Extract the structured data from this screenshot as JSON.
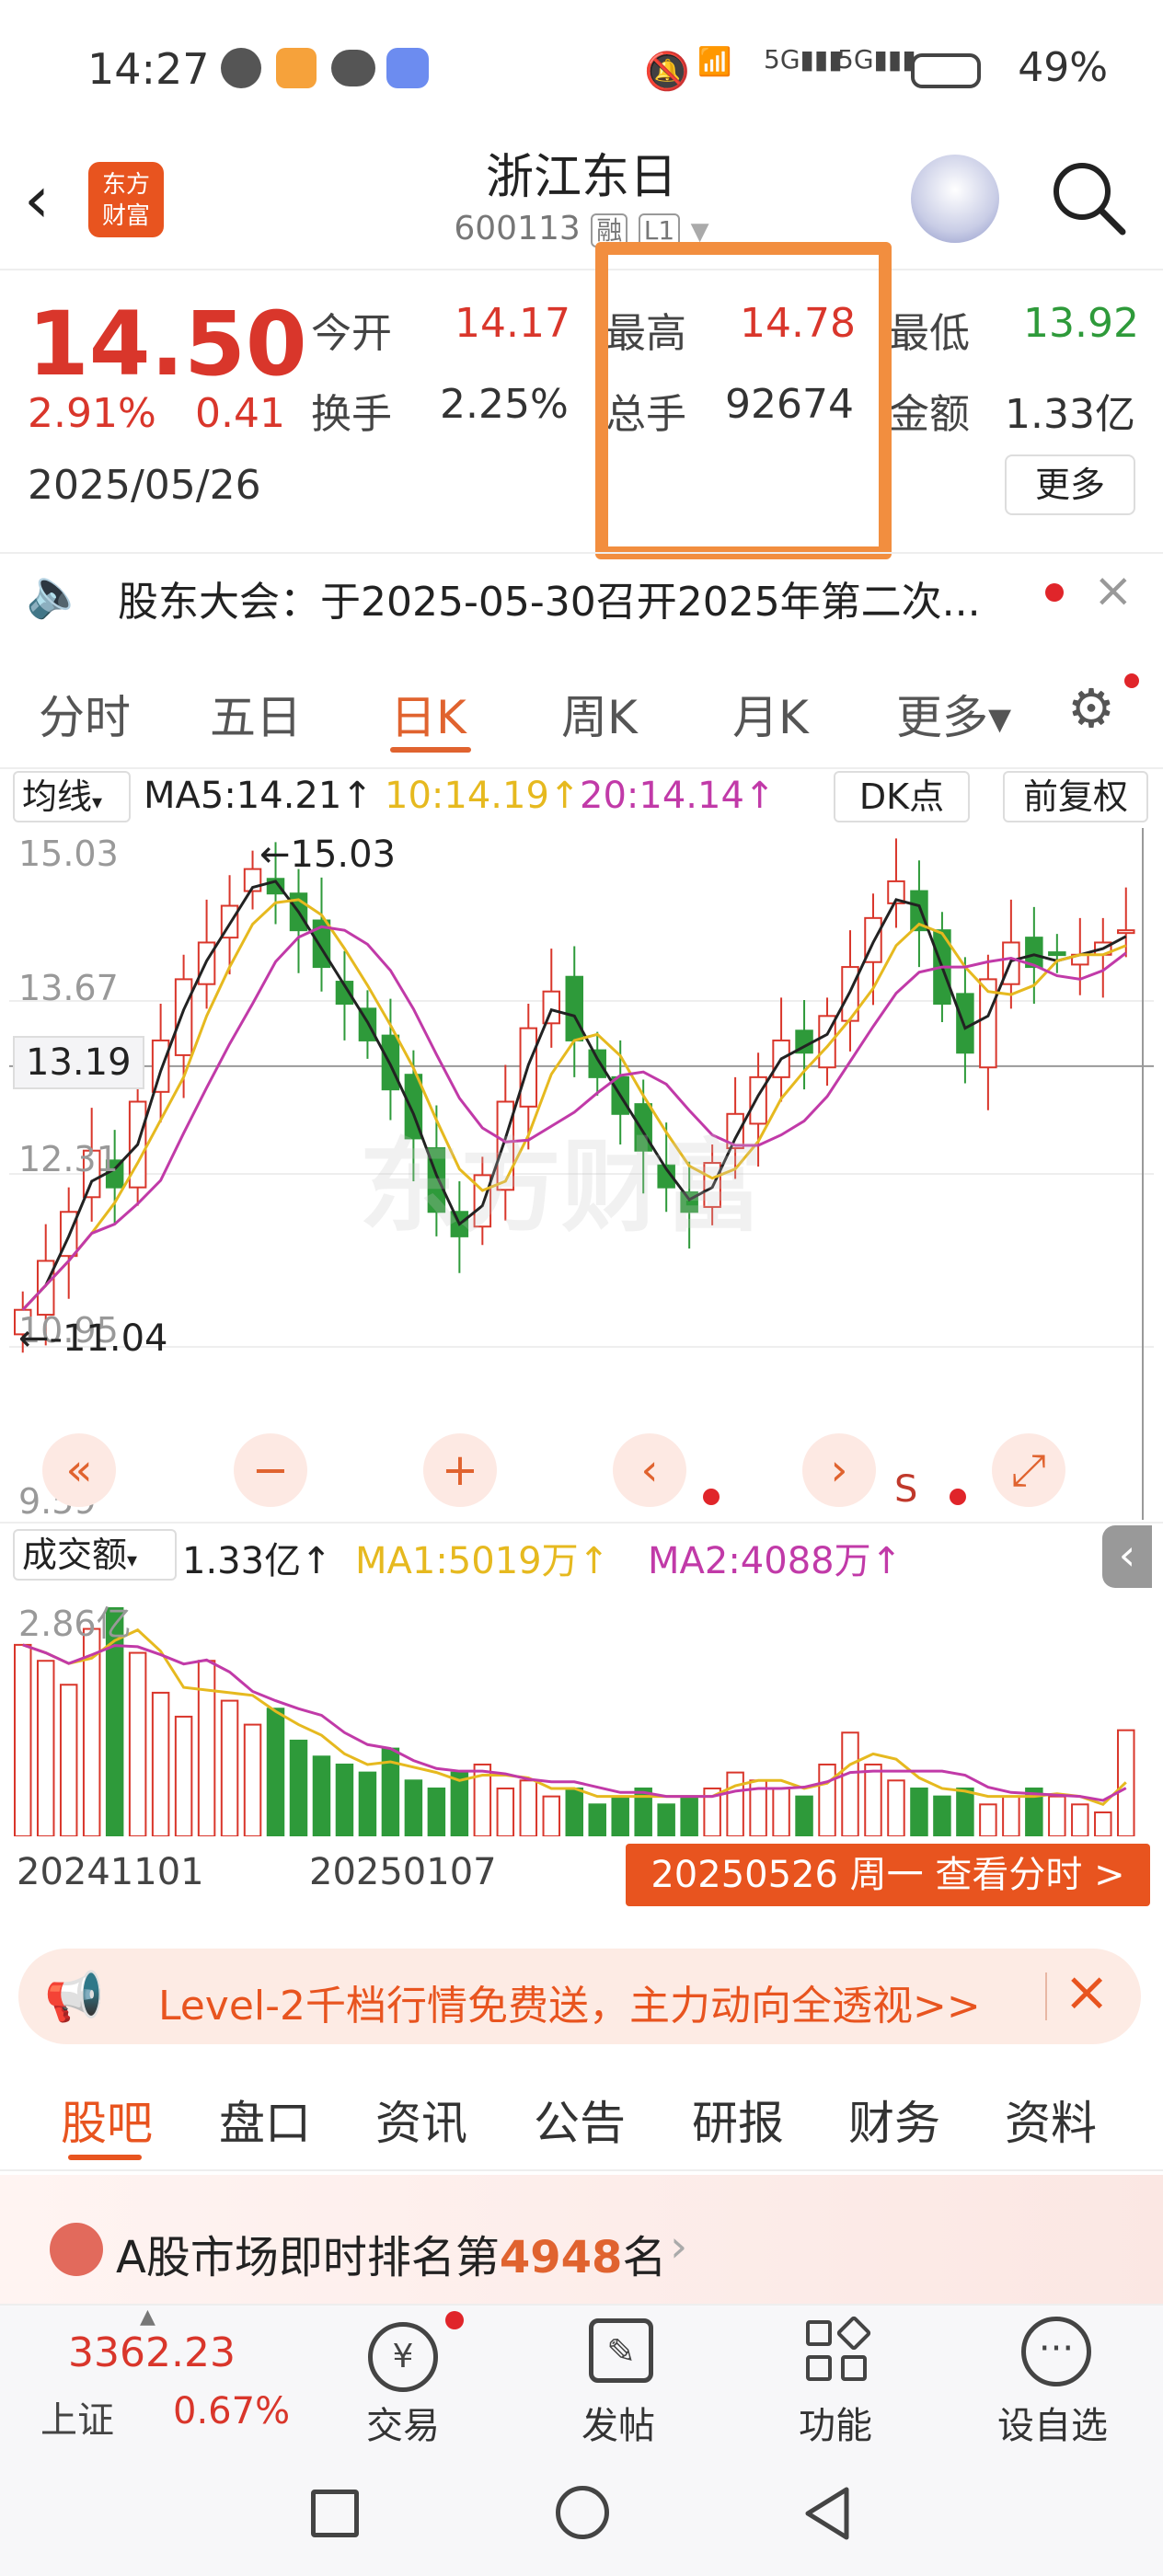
{
  "status_bar": {
    "time": "14:27",
    "battery": "49%",
    "net1": "5G",
    "net2": "5G"
  },
  "header": {
    "title": "浙江东日",
    "code": "600113",
    "tag1": "融",
    "tag2": "L1",
    "logo_text": "东方\n财富"
  },
  "quote": {
    "price": "14.50",
    "change_pct": "2.91%",
    "change": "0.41",
    "date": "2025/05/26",
    "open_label": "今开",
    "open": "14.17",
    "high_label": "最高",
    "high": "14.78",
    "low_label": "最低",
    "low": "13.92",
    "turnover_label": "换手",
    "turnover": "2.25%",
    "volume_label": "总手",
    "volume": "92674",
    "amount_label": "金额",
    "amount": "1.33亿",
    "more_label": "更多"
  },
  "notice": {
    "text": "股东大会：于2025-05-30召开2025年第二次..."
  },
  "tabs": [
    {
      "label": "分时"
    },
    {
      "label": "五日"
    },
    {
      "label": "日K"
    },
    {
      "label": "周K"
    },
    {
      "label": "月K"
    },
    {
      "label": "更多▾"
    }
  ],
  "active_tab": "日K",
  "ma_bar": {
    "selector": "均线",
    "ma5": "MA5:14.21↑",
    "ma10": "10:14.19↑",
    "ma20": "20:14.14↑",
    "dk": "DK点",
    "adjust": "前复权"
  },
  "price_chart": {
    "y_labels": [
      "15.03",
      "13.67",
      "12.31",
      "10.95",
      "9.59"
    ],
    "current_line": "13.19",
    "max_marker": "←15.03",
    "min_marker": "←-11.04",
    "watermark": "东方财富"
  },
  "volume_bar": {
    "selector": "成交额",
    "value": "1.33亿↑",
    "ma1": "MA1:5019万↑",
    "ma2": "MA2:4088万↑",
    "y_top": "2.86亿"
  },
  "x_labels": [
    "20241101",
    "20250107"
  ],
  "date_button": "20250526 周一 查看分时 >",
  "promo": {
    "text": "Level-2千档行情免费送，主力动向全透视>>"
  },
  "bottom_tabs": [
    {
      "label": "股吧"
    },
    {
      "label": "盘口"
    },
    {
      "label": "资讯"
    },
    {
      "label": "公告"
    },
    {
      "label": "研报"
    },
    {
      "label": "财务"
    },
    {
      "label": "资料"
    }
  ],
  "rank": {
    "prefix": "A股市场即时排名第",
    "num": "4948",
    "suffix": "名"
  },
  "dock": {
    "index_value": "3362.23",
    "index_name": "上证",
    "index_pct": "0.67%",
    "items": [
      {
        "label": "交易"
      },
      {
        "label": "发帖"
      },
      {
        "label": "功能"
      },
      {
        "label": "设自选"
      }
    ]
  },
  "chart_data": {
    "type": "candlestick",
    "ylim": [
      9.59,
      15.03
    ],
    "values": [
      11.2,
      11.6,
      12.0,
      12.5,
      12.2,
      12.9,
      13.4,
      13.9,
      14.2,
      14.5,
      14.8,
      14.6,
      14.3,
      14.0,
      13.7,
      13.4,
      13.0,
      12.6,
      12.0,
      11.8,
      12.3,
      12.9,
      13.5,
      13.8,
      13.4,
      13.1,
      12.8,
      12.5,
      12.2,
      12.0,
      12.4,
      12.8,
      13.1,
      13.4,
      13.3,
      13.6,
      14.0,
      14.4,
      14.7,
      14.3,
      13.7,
      13.3,
      13.9,
      14.2,
      14.0,
      14.1,
      14.1,
      14.2,
      14.3
    ],
    "volumes": [
      2.4,
      2.2,
      1.9,
      2.6,
      2.86,
      2.3,
      1.8,
      1.5,
      2.2,
      1.7,
      1.4,
      1.6,
      1.2,
      1.0,
      0.9,
      0.8,
      1.1,
      0.7,
      0.6,
      0.8,
      0.9,
      0.6,
      0.7,
      0.5,
      0.6,
      0.4,
      0.5,
      0.6,
      0.4,
      0.5,
      0.6,
      0.8,
      0.7,
      0.6,
      0.5,
      0.9,
      1.3,
      0.9,
      0.7,
      0.6,
      0.5,
      0.6,
      0.4,
      0.5,
      0.6,
      0.5,
      0.4,
      0.3,
      1.33
    ]
  }
}
